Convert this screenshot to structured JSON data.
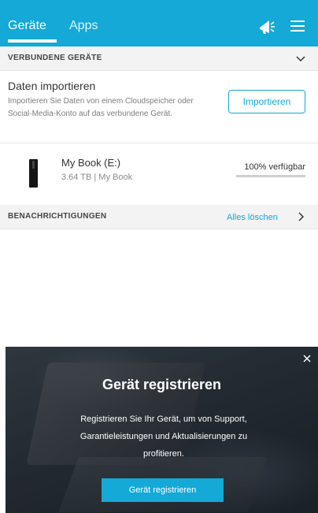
{
  "header": {
    "tabs": [
      {
        "label": "Geräte",
        "active": true
      },
      {
        "label": "Apps",
        "active": false
      }
    ],
    "icons": [
      "megaphone-icon",
      "menu-icon"
    ],
    "color": "#14a9d6"
  },
  "connected": {
    "title": "VERBUNDENE GERÄTE",
    "import_title": "Daten importieren",
    "import_desc": "Importieren Sie Daten von einem Cloudspeicher oder Social-Media-Konto auf das verbundene Gerät.",
    "import_button": "Importieren",
    "device": {
      "name": "My Book (E:)",
      "detail": "3.64 TB | My Book",
      "availability": "100% verfügbar",
      "available_fraction": 1.0
    }
  },
  "notifications": {
    "title": "BENACHRICHTIGUNGEN",
    "clear_all": "Alles löschen"
  },
  "banner": {
    "title": "Gerät registrieren",
    "text": "Registrieren Sie Ihr Gerät, um von Support, Garantieleistungen und Aktualisierungen zu profitieren.",
    "button": "Gerät registrieren"
  }
}
